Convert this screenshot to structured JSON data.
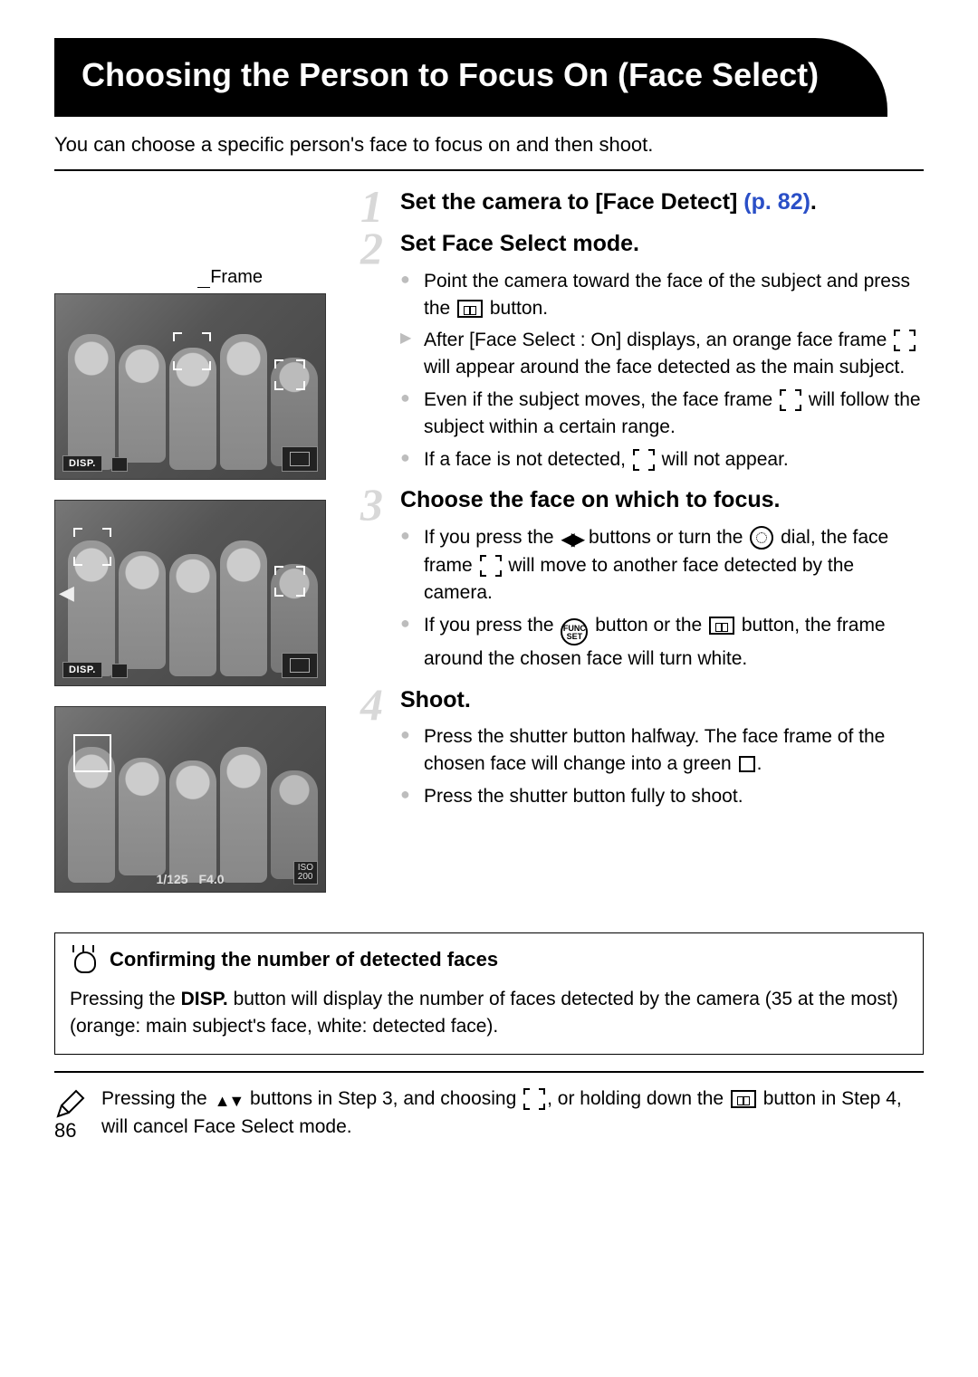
{
  "title": "Choosing the Person to Focus On (Face Select)",
  "intro": "You can choose a specific person's face to focus on and then shoot.",
  "frame_label": "Frame",
  "lcd": {
    "disp": "DISP.",
    "shutter": "1/125",
    "aperture": "F4.0",
    "iso_label": "ISO",
    "iso_value": "200"
  },
  "steps": [
    {
      "num": "1",
      "title_a": "Set the camera to [Face Detect] ",
      "title_b": "(p. 82)",
      "title_c": "."
    },
    {
      "num": "2",
      "title": "Set Face Select mode.",
      "bullets": [
        {
          "type": "dot",
          "pre": "Point the camera toward the face of the subject and press the ",
          "post": " button."
        },
        {
          "type": "arrow",
          "pre": "After [Face Select : On] displays, an orange face frame ",
          "post": " will appear around the face detected as the main subject."
        },
        {
          "type": "dot",
          "pre": "Even if the subject moves, the face frame ",
          "post": " will follow the subject within a certain range."
        },
        {
          "type": "dot",
          "pre": "If a face is not detected, ",
          "post": " will not appear."
        }
      ]
    },
    {
      "num": "3",
      "title": "Choose the face on which to focus.",
      "bullets": [
        {
          "type": "dot",
          "pre": "If you press the ",
          "mid1": " buttons or turn the ",
          "mid2": " dial, the face frame ",
          "post": " will move to another face detected by the camera."
        },
        {
          "type": "dot",
          "pre": "If you press the ",
          "mid1": " button or the ",
          "post": " button, the frame around the chosen face will turn white."
        }
      ]
    },
    {
      "num": "4",
      "title": "Shoot.",
      "bullets": [
        {
          "type": "dot",
          "pre": "Press the shutter button halfway. The face frame of the chosen face will change into a green ",
          "post": "."
        },
        {
          "type": "dot",
          "text": "Press the shutter button fully to shoot."
        }
      ]
    }
  ],
  "tip": {
    "title": "Confirming the number of detected faces",
    "body_pre": "Pressing the ",
    "disp": "DISP.",
    "body_post": " button will display the number of faces detected by the camera (35 at the most) (orange: main subject's face, white: detected face)."
  },
  "note": {
    "pre": "Pressing the ",
    "mid1": " buttons in Step 3, and choosing ",
    "mid2": ", or holding down the ",
    "post": " button in Step 4, will cancel Face Select mode."
  },
  "func_label": "FUNC SET",
  "page_number": "86"
}
